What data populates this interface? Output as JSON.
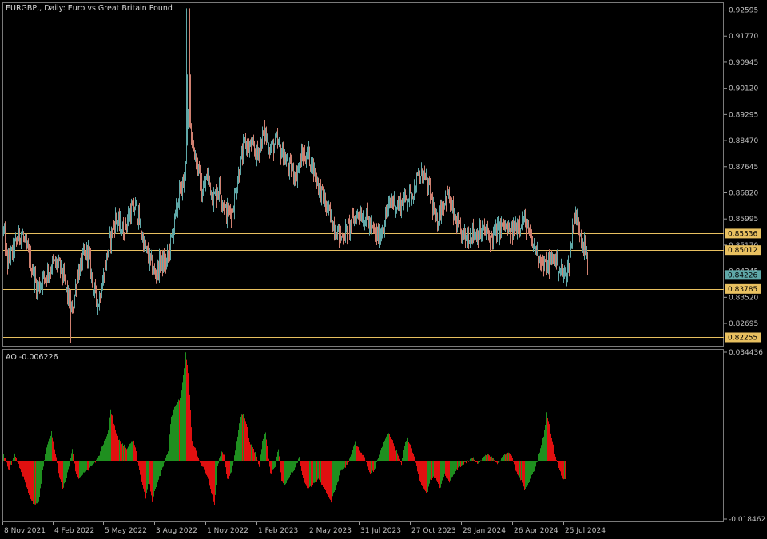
{
  "chart_data": [
    {
      "type": "candlestick",
      "title": "EURGBP,, Daily:  Euro vs Great Britain Pound",
      "symbol": "EURGBP,",
      "timeframe": "Daily",
      "description": "Euro vs Great Britain Pound",
      "y_ticks": [
        "0.92595",
        "0.91770",
        "0.90945",
        "0.90120",
        "0.89295",
        "0.88470",
        "0.87645",
        "0.86820",
        "0.85995",
        "0.85170",
        "0.84345",
        "0.83520",
        "0.82695"
      ],
      "ylim": [
        0.8199,
        0.9281
      ],
      "x_ticks": [
        "8 Nov 2021",
        "4 Feb 2022",
        "5 May 2022",
        "3 Aug 2022",
        "1 Nov 2022",
        "1 Feb 2023",
        "2 May 2023",
        "31 Jul 2023",
        "27 Oct 2023",
        "29 Jan 2024",
        "26 Apr 2024",
        "25 Jul 2024"
      ],
      "levels": [
        {
          "value": 0.85536,
          "label": "0.85536",
          "color": "#e8c060"
        },
        {
          "value": 0.85012,
          "label": "0.85012",
          "color": "#e8c060"
        },
        {
          "value": 0.83785,
          "label": "0.83785",
          "color": "#e8c060"
        },
        {
          "value": 0.82255,
          "label": "0.82255",
          "color": "#e8c060"
        }
      ],
      "current_price": {
        "value": 0.84226,
        "label": "0.84226",
        "color": "#5fa8a8"
      },
      "up_color": "#5fa8a8",
      "down_color": "#d08070",
      "trend": [
        [
          0,
          0.856
        ],
        [
          5,
          0.846
        ],
        [
          12,
          0.85
        ],
        [
          22,
          0.856
        ],
        [
          32,
          0.848
        ],
        [
          42,
          0.838
        ],
        [
          52,
          0.842
        ],
        [
          62,
          0.846
        ],
        [
          72,
          0.844
        ],
        [
          80,
          0.836
        ],
        [
          86,
          0.83
        ],
        [
          92,
          0.842
        ],
        [
          100,
          0.848
        ],
        [
          106,
          0.85
        ],
        [
          112,
          0.838
        ],
        [
          118,
          0.833
        ],
        [
          124,
          0.84
        ],
        [
          132,
          0.852
        ],
        [
          140,
          0.86
        ],
        [
          150,
          0.856
        ],
        [
          158,
          0.862
        ],
        [
          166,
          0.864
        ],
        [
          172,
          0.856
        ],
        [
          178,
          0.85
        ],
        [
          184,
          0.846
        ],
        [
          190,
          0.842
        ],
        [
          196,
          0.846
        ],
        [
          204,
          0.846
        ],
        [
          212,
          0.856
        ],
        [
          220,
          0.868
        ],
        [
          226,
          0.872
        ],
        [
          232,
          0.896
        ],
        [
          236,
          0.884
        ],
        [
          242,
          0.878
        ],
        [
          248,
          0.868
        ],
        [
          256,
          0.874
        ],
        [
          262,
          0.866
        ],
        [
          270,
          0.87
        ],
        [
          278,
          0.862
        ],
        [
          286,
          0.862
        ],
        [
          294,
          0.874
        ],
        [
          302,
          0.884
        ],
        [
          310,
          0.882
        ],
        [
          318,
          0.88
        ],
        [
          326,
          0.888
        ],
        [
          334,
          0.882
        ],
        [
          342,
          0.884
        ],
        [
          350,
          0.88
        ],
        [
          358,
          0.876
        ],
        [
          366,
          0.874
        ],
        [
          374,
          0.88
        ],
        [
          382,
          0.88
        ],
        [
          390,
          0.874
        ],
        [
          398,
          0.868
        ],
        [
          406,
          0.862
        ],
        [
          414,
          0.858
        ],
        [
          422,
          0.854
        ],
        [
          430,
          0.856
        ],
        [
          438,
          0.86
        ],
        [
          446,
          0.862
        ],
        [
          454,
          0.86
        ],
        [
          462,
          0.856
        ],
        [
          470,
          0.854
        ],
        [
          478,
          0.86
        ],
        [
          486,
          0.866
        ],
        [
          494,
          0.864
        ],
        [
          502,
          0.866
        ],
        [
          510,
          0.868
        ],
        [
          518,
          0.872
        ],
        [
          526,
          0.874
        ],
        [
          534,
          0.868
        ],
        [
          542,
          0.858
        ],
        [
          548,
          0.864
        ],
        [
          556,
          0.868
        ],
        [
          562,
          0.862
        ],
        [
          570,
          0.856
        ],
        [
          578,
          0.854
        ],
        [
          586,
          0.856
        ],
        [
          594,
          0.855
        ],
        [
          602,
          0.856
        ],
        [
          610,
          0.854
        ],
        [
          618,
          0.856
        ],
        [
          626,
          0.858
        ],
        [
          634,
          0.855
        ],
        [
          642,
          0.858
        ],
        [
          650,
          0.86
        ],
        [
          656,
          0.856
        ],
        [
          662,
          0.852
        ],
        [
          668,
          0.85
        ],
        [
          676,
          0.845
        ],
        [
          684,
          0.846
        ],
        [
          690,
          0.848
        ],
        [
          696,
          0.844
        ],
        [
          702,
          0.842
        ],
        [
          708,
          0.845
        ],
        [
          714,
          0.862
        ],
        [
          720,
          0.858
        ],
        [
          726,
          0.852
        ],
        [
          732,
          0.844
        ],
        [
          735,
          0.8423
        ]
      ],
      "spikes": [
        {
          "x": 88,
          "low": 0.8208
        },
        {
          "x": 233,
          "high": 0.9265
        },
        {
          "x": 234,
          "high": 0.9056
        }
      ]
    },
    {
      "type": "histogram",
      "title": "AO -0.006226",
      "indicator": "AO",
      "value": "-0.006226",
      "y_ticks": [
        "0.034436",
        "-0.018462"
      ],
      "ylim": [
        -0.018462,
        0.034436
      ],
      "zero": 0,
      "colors": {
        "rising": "#1f8f1f",
        "falling": "#e01010"
      },
      "x": [
        0,
        7,
        14,
        20,
        26,
        32,
        38,
        44,
        48,
        52,
        56,
        60,
        64,
        70,
        74,
        78,
        82,
        86,
        90,
        94,
        100,
        106,
        112,
        116,
        120,
        124,
        130,
        134,
        138,
        142,
        146,
        150,
        154,
        158,
        162,
        166,
        170,
        174,
        178,
        182,
        186,
        190,
        194,
        198,
        202,
        206,
        210,
        216,
        222,
        228,
        232,
        236,
        240,
        246,
        252,
        256,
        260,
        264,
        268,
        272,
        276,
        280,
        286,
        292,
        296,
        300,
        304,
        308,
        312,
        316,
        320,
        324,
        328,
        334,
        340,
        344,
        348,
        352,
        356,
        360,
        364,
        370,
        376,
        382,
        388,
        394,
        400,
        406,
        410,
        414,
        418,
        422,
        428,
        434,
        440,
        446,
        452,
        458,
        464,
        470,
        476,
        482,
        486,
        490,
        494,
        498,
        502,
        506,
        512,
        518,
        522,
        526,
        530,
        534,
        540,
        546,
        552,
        558,
        564,
        570,
        576,
        582,
        588,
        594,
        600,
        606,
        612,
        618,
        624,
        630,
        636,
        640,
        644,
        648,
        652,
        656,
        660,
        664,
        668,
        672,
        676,
        680,
        684,
        688,
        692,
        696,
        700,
        704,
        708,
        712,
        716,
        720,
        724,
        728,
        732,
        735
      ],
      "values": [
        0.002,
        -0.003,
        0.002,
        -0.002,
        -0.006,
        -0.011,
        -0.014,
        -0.013,
        -0.005,
        0.002,
        0.006,
        0.009,
        0.004,
        -0.005,
        -0.009,
        -0.006,
        -0.002,
        0.004,
        -0.003,
        -0.006,
        -0.004,
        -0.003,
        -0.001,
        0.0,
        0.002,
        0.005,
        0.008,
        0.016,
        0.012,
        0.008,
        0.006,
        0.005,
        0.004,
        0.005,
        0.007,
        0.003,
        -0.003,
        -0.008,
        -0.012,
        -0.006,
        -0.013,
        -0.009,
        -0.006,
        -0.003,
        0.0,
        0.003,
        0.014,
        0.018,
        0.02,
        0.034,
        0.026,
        0.006,
        0.004,
        -0.001,
        -0.003,
        -0.006,
        -0.01,
        -0.014,
        -0.002,
        0.003,
        0.002,
        -0.006,
        -0.003,
        0.006,
        0.014,
        0.015,
        0.012,
        0.006,
        0.004,
        0.002,
        -0.002,
        0.006,
        0.009,
        -0.004,
        -0.002,
        0.004,
        -0.006,
        -0.008,
        -0.006,
        -0.004,
        -0.003,
        0.001,
        -0.007,
        -0.009,
        -0.007,
        -0.006,
        -0.008,
        -0.011,
        -0.013,
        -0.01,
        -0.007,
        -0.003,
        -0.002,
        0.001,
        0.006,
        0.003,
        0.001,
        -0.004,
        -0.003,
        0.002,
        0.006,
        0.009,
        0.007,
        0.004,
        0.002,
        -0.001,
        0.005,
        0.007,
        0.003,
        -0.003,
        -0.007,
        -0.009,
        -0.011,
        -0.006,
        -0.005,
        -0.009,
        -0.004,
        -0.007,
        -0.004,
        -0.002,
        -0.001,
        0.0,
        0.001,
        -0.001,
        0.001,
        0.002,
        0.001,
        -0.001,
        0.001,
        0.003,
        0.002,
        -0.002,
        -0.005,
        -0.006,
        -0.009,
        -0.008,
        -0.005,
        -0.003,
        0.0,
        0.004,
        0.008,
        0.015,
        0.01,
        0.005,
        0.0,
        -0.003,
        -0.006,
        -0.0062
      ]
    }
  ]
}
